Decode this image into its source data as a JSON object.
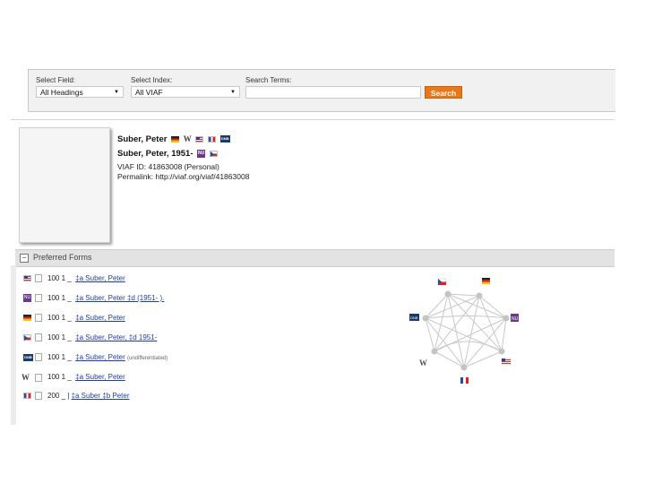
{
  "search": {
    "field_label": "Select Field:",
    "field_value": "All Headings",
    "index_label": "Select Index:",
    "index_value": "All VIAF",
    "terms_label": "Search Terms:",
    "terms_value": "",
    "button_label": "Search"
  },
  "record": {
    "name1": "Suber, Peter",
    "name2": "Suber, Peter, 1951-",
    "viaf_id": "VIAF ID: 41863008 (Personal)",
    "permalink": "Permalink: http://viaf.org/viaf/41863008"
  },
  "preferred_forms": {
    "title": "Preferred Forms",
    "rows": [
      {
        "source": "us-flag",
        "tag": "100 1 _",
        "link": "‡a  Suber, Peter",
        "note": ""
      },
      {
        "source": "nu-logo",
        "tag": "100 1 _",
        "link": "‡a  Suber, Peter ‡d  (1951- ).",
        "note": ""
      },
      {
        "source": "de-flag",
        "tag": "100 1 _",
        "link": "‡a  Suber, Peter",
        "note": ""
      },
      {
        "source": "cz-flag",
        "tag": "100 1 _",
        "link": "‡a  Suber, Peter, ‡d  1951-",
        "note": ""
      },
      {
        "source": "dnb-logo",
        "tag": "100 1 _",
        "link": "‡a  Suber, Peter",
        "note": "(undifferentiated)"
      },
      {
        "source": "wikipedia-logo",
        "tag": "100 1 _",
        "link": "‡a  Suber, Peter",
        "note": ""
      },
      {
        "source": "fr-flag",
        "tag": "200 _ |",
        "link": "‡a  Suber ‡b  Peter",
        "note": ""
      }
    ]
  },
  "graph": {
    "nodes": [
      "cz-flag",
      "de-flag",
      "nu-logo",
      "us-flag",
      "fr-flag",
      "wikipedia-logo",
      "dnb-logo"
    ]
  }
}
